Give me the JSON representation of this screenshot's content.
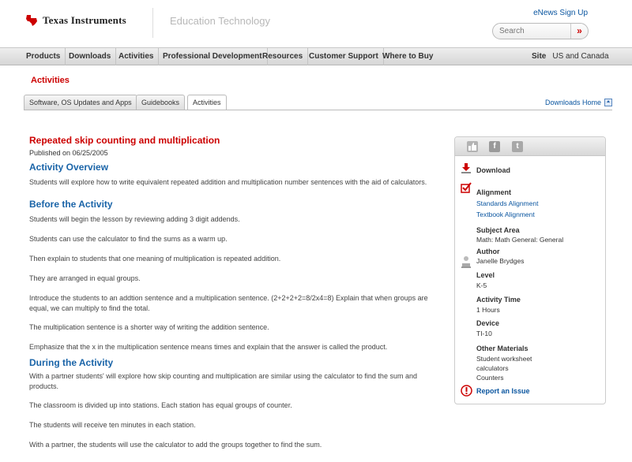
{
  "header": {
    "logo_text": "Texas Instruments",
    "tagline": "Education Technology",
    "enews_label": "eNews Sign Up",
    "search_placeholder": "Search",
    "search_button": "»"
  },
  "nav": {
    "items": [
      "Products",
      "Downloads",
      "Activities",
      "Professional Development",
      "Resources",
      "Customer Support",
      "Where to Buy"
    ],
    "site_label": "Site",
    "site_value": "US and Canada"
  },
  "section_title": "Activities",
  "tabs": [
    "Software, OS Updates and Apps",
    "Guidebooks",
    "Activities"
  ],
  "active_tab": "Activities",
  "downloads_home": "Downloads Home",
  "article": {
    "title": "Repeated skip counting and multiplication",
    "published": "Published on 06/25/2005",
    "overview_heading": "Activity Overview",
    "overview_text": "Students will explore how to write equivalent repeated addition and multiplication number sentences with the aid of calculators.",
    "before_heading": "Before the Activity",
    "before_paragraphs": [
      "Students will begin the lesson by reviewing adding 3 digit addends.",
      "Students can use the calculator to find the sums as a warm up.",
      "Then explain to students that one meaning of multiplication is repeated addition.",
      "They are arranged in equal groups.",
      "Introduce the students to an addtion sentence and a multiplication sentence. (2+2+2+2=8/2x4=8) Explain that when groups are equal, we can multiply to find the total.",
      "The multiplication sentence is a shorter way of writing the addition sentence.",
      "Emphasize that the x in the multiplication sentence means times and explain that the answer is called the product."
    ],
    "during_heading": "During the Activity",
    "during_paragraphs": [
      "With a partner students' will explore how skip counting and multiplication are similar using the calculator to find the sum and products.",
      "The classroom is divided up into stations. Each station has equal groups of counter.",
      "The students will receive ten minutes in each station.",
      "With a partner, the students will use the calculator to add the groups together to find the sum."
    ]
  },
  "sidebar": {
    "social_icons": [
      "like-icon",
      "facebook-icon",
      "twitter-icon"
    ],
    "download_label": "Download",
    "alignment_label": "Alignment",
    "standards_link": "Standards Alignment",
    "textbook_link": "Textbook Alignment",
    "subject_label": "Subject Area",
    "subject_value": "Math: Math General: General",
    "author_label": "Author",
    "author_value": "Janelle Brydges",
    "level_label": "Level",
    "level_value": "K-5",
    "time_label": "Activity Time",
    "time_value": "1 Hours",
    "device_label": "Device",
    "device_value": "TI-10",
    "materials_label": "Other Materials",
    "materials_values": [
      "Student worksheet",
      "calculators",
      "Counters"
    ],
    "report_label": "Report an Issue"
  },
  "colors": {
    "brand_red": "#cc0000",
    "heading_blue": "#1a64a8",
    "link_blue": "#0b56a0"
  }
}
